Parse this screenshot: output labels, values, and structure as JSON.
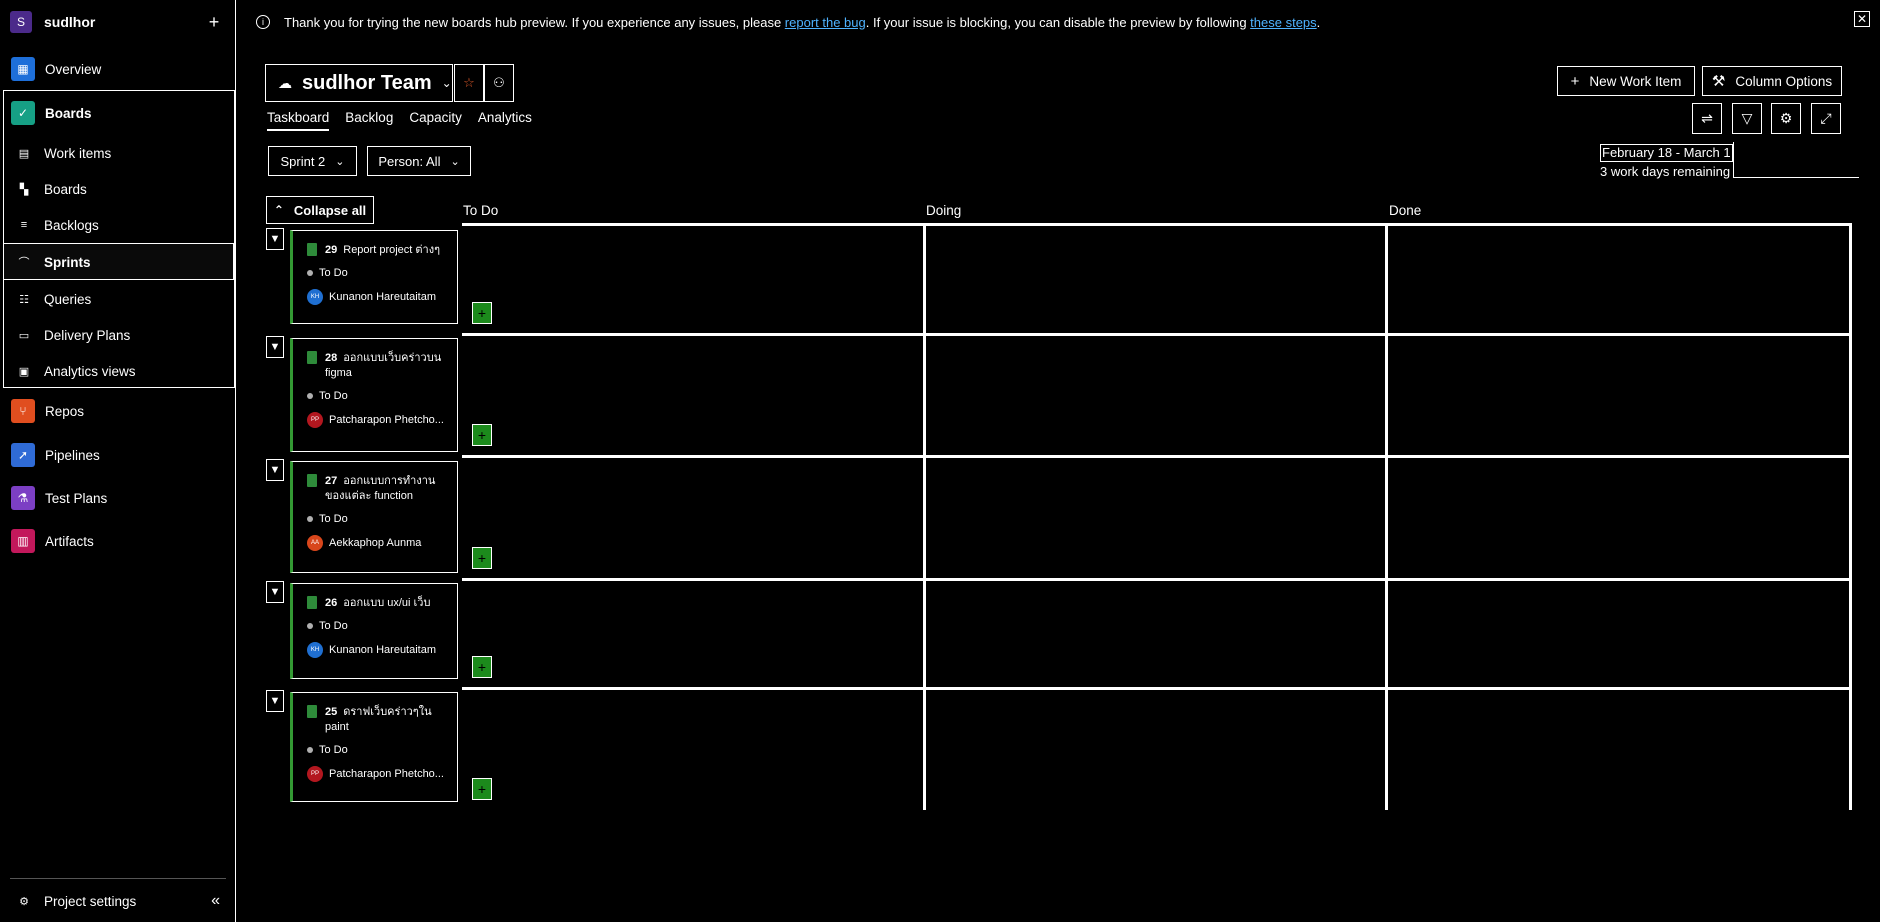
{
  "org": {
    "initial": "S",
    "name": "sudlhor",
    "add_label": "+"
  },
  "nav": {
    "overview": "Overview",
    "boards": "Boards",
    "work_items": "Work items",
    "boards_sub": "Boards",
    "backlogs": "Backlogs",
    "sprints": "Sprints",
    "queries": "Queries",
    "delivery_plans": "Delivery Plans",
    "analytics_views": "Analytics views",
    "repos": "Repos",
    "pipelines": "Pipelines",
    "test_plans": "Test Plans",
    "artifacts": "Artifacts",
    "project_settings": "Project settings",
    "collapse": "«"
  },
  "banner": {
    "text1": "Thank you for trying the new boards hub preview. If you experience any issues, please ",
    "link1": "report the bug",
    "text2": ". If your issue is blocking, you can disable the preview by following ",
    "link2": "these steps",
    "text3": ".",
    "close": "✕"
  },
  "header": {
    "team": "sudlhor Team",
    "tabs": [
      "Taskboard",
      "Backlog",
      "Capacity",
      "Analytics"
    ],
    "new_work_item": "New Work Item",
    "column_options": "Column Options",
    "sprint": "Sprint 2",
    "person": "Person: All",
    "date_range": "February 18 - March 1",
    "remaining": "3 work days remaining"
  },
  "board": {
    "collapse_all": "Collapse all",
    "columns": [
      "To Do",
      "Doing",
      "Done"
    ],
    "items": [
      {
        "id": "29",
        "title": "Report project ต่างๆ",
        "state": "To Do",
        "initials": "KH",
        "assignee": "Kunanon Hareutaitam",
        "color": "#1f6fd1"
      },
      {
        "id": "28",
        "title": "ออกแบบเว็บคร่าวบน figma",
        "state": "To Do",
        "initials": "PP",
        "assignee": "Patcharapon Phetcho...",
        "color": "#b3171f"
      },
      {
        "id": "27",
        "title": "ออกแบบการทำงานของแต่ละ function",
        "state": "To Do",
        "initials": "AA",
        "assignee": "Aekkaphop Aunma",
        "color": "#d8461b"
      },
      {
        "id": "26",
        "title": "ออกแบบ ux/ui เว็บ",
        "state": "To Do",
        "initials": "KH",
        "assignee": "Kunanon Hareutaitam",
        "color": "#1f6fd1"
      },
      {
        "id": "25",
        "title": "ดราฟเว็บคร่าวๆใน paint",
        "state": "To Do",
        "initials": "PP",
        "assignee": "Patcharapon Phetcho...",
        "color": "#b3171f"
      }
    ]
  },
  "colors": {
    "accent_green": "#339933",
    "link": "#4fb3ff",
    "org_purple": "#4b2a8a"
  }
}
